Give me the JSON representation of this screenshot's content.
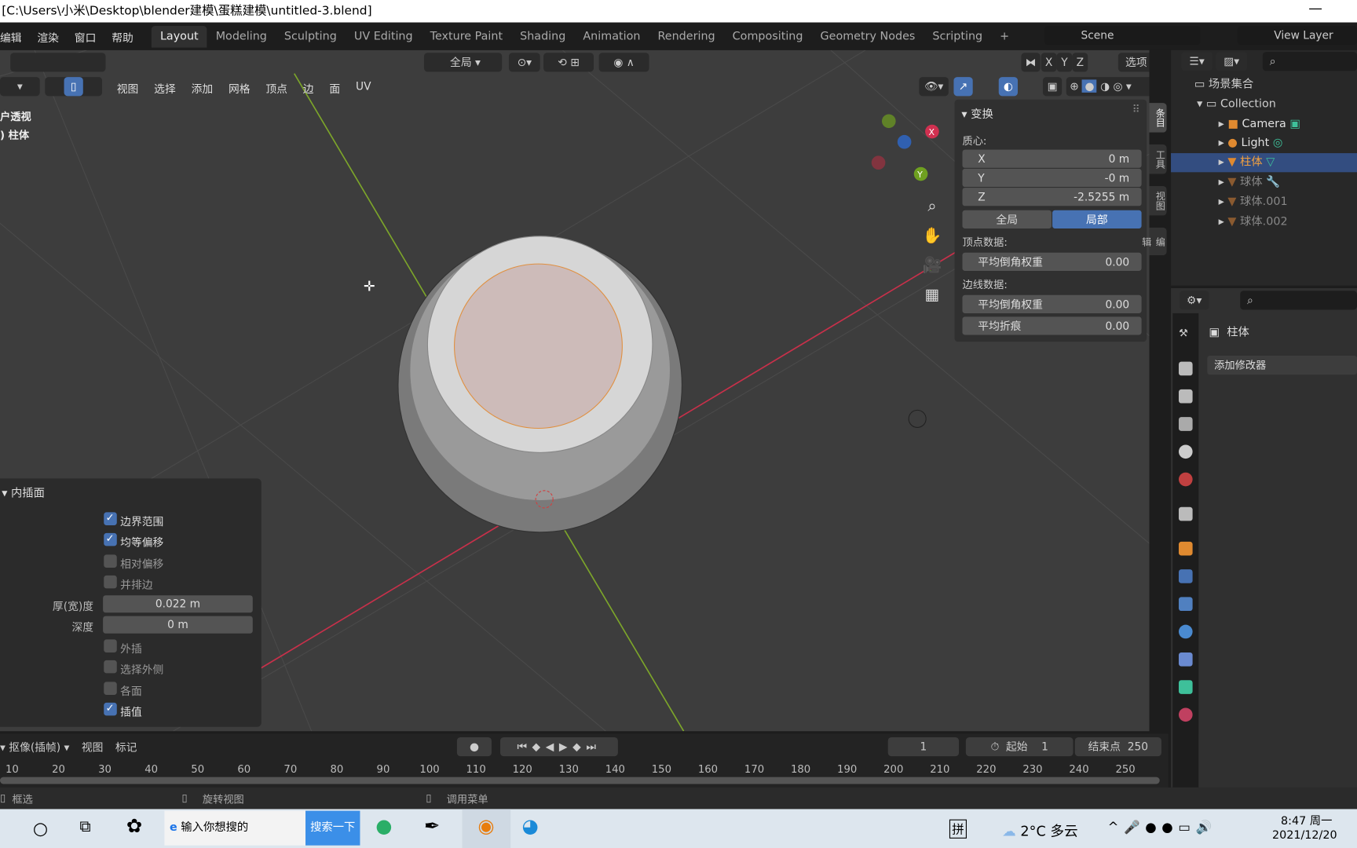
{
  "window": {
    "title": "[C:\\Users\\小米\\Desktop\\blender建模\\蛋糕建模\\untitled-3.blend]",
    "controls": "—"
  },
  "menus": [
    "编辑",
    "渲染",
    "窗口",
    "帮助"
  ],
  "workspaces": [
    "Layout",
    "Modeling",
    "Sculpting",
    "UV Editing",
    "Texture Paint",
    "Shading",
    "Animation",
    "Rendering",
    "Compositing",
    "Geometry Nodes",
    "Scripting"
  ],
  "add_workspace": "+",
  "scene": {
    "name": "Scene",
    "view_layer": "View Layer"
  },
  "tool_header": {
    "orientation": "全局",
    "options": "选项",
    "axes": [
      "X",
      "Y",
      "Z"
    ]
  },
  "edit_header": {
    "menus": [
      "视图",
      "选择",
      "添加",
      "网格",
      "顶点",
      "边",
      "面",
      "UV"
    ]
  },
  "viewport": {
    "overlay_text": [
      "户透视",
      ") 柱体"
    ],
    "gizmo_axes": [
      "X",
      "Y",
      "Z"
    ]
  },
  "npanel": {
    "title": "变换",
    "median_label": "质心:",
    "x_label": "X",
    "x": "0 m",
    "y_label": "Y",
    "y": "-0 m",
    "z_label": "Z",
    "z": "-2.5255 m",
    "global": "全局",
    "local": "局部",
    "vertex_data": "顶点数据:",
    "vertex_bevel_label": "平均倒角权重",
    "vertex_bevel": "0.00",
    "edge_data": "边线数据:",
    "edge_bevel_label": "平均倒角权重",
    "edge_bevel": "0.00",
    "crease_label": "平均折痕",
    "crease": "0.00",
    "tabs": [
      "条目",
      "工具",
      "视图",
      "编辑"
    ]
  },
  "outliner": {
    "root": "场景集合",
    "collection": "Collection",
    "items": [
      {
        "name": "Camera",
        "color": "#e0e0e0"
      },
      {
        "name": "Light",
        "color": "#e0e0e0"
      },
      {
        "name": "柱体",
        "color": "#f0a040",
        "selected": true
      },
      {
        "name": "球体",
        "color": "#888"
      },
      {
        "name": "球体.001",
        "color": "#888"
      },
      {
        "name": "球体.002",
        "color": "#888"
      }
    ]
  },
  "properties": {
    "object_name": "柱体",
    "add_modifier": "添加修改器"
  },
  "operator": {
    "title": "内插面",
    "checkboxes": [
      {
        "label": "边界范围",
        "checked": true
      },
      {
        "label": "均等偏移",
        "checked": true
      },
      {
        "label": "相对偏移",
        "checked": false
      },
      {
        "label": "并排边",
        "checked": false
      }
    ],
    "thickness_label": "厚(宽)度",
    "thickness": "0.022 m",
    "depth_label": "深度",
    "depth": "0 m",
    "checkboxes2": [
      {
        "label": "外插",
        "checked": false
      },
      {
        "label": "选择外侧",
        "checked": false
      },
      {
        "label": "各面",
        "checked": false
      },
      {
        "label": "插值",
        "checked": true
      }
    ]
  },
  "timeline": {
    "keying": "抠像(插帧)",
    "view": "视图",
    "marker": "标记",
    "current_frame": "1",
    "start_label": "起始",
    "start": "1",
    "end_label": "结束点",
    "end": "250",
    "ticks": [
      "10",
      "20",
      "30",
      "40",
      "50",
      "60",
      "70",
      "80",
      "90",
      "100",
      "110",
      "120",
      "130",
      "140",
      "150",
      "160",
      "170",
      "180",
      "190",
      "200",
      "210",
      "220",
      "230",
      "240",
      "250"
    ]
  },
  "status": {
    "select": "框选",
    "rotate": "旋转视图",
    "menu": "调用菜单"
  },
  "taskbar": {
    "search_placeholder": "输入你想搜的",
    "search_button": "搜索一下",
    "ime": "拼",
    "weather": "2°C 多云",
    "time": "8:47 周一",
    "date": "2021/12/20"
  },
  "colors": {
    "accent": "#4772b3",
    "x_axis": "#c8304a",
    "y_axis": "#6f9a20",
    "selection": "#f0a040"
  }
}
